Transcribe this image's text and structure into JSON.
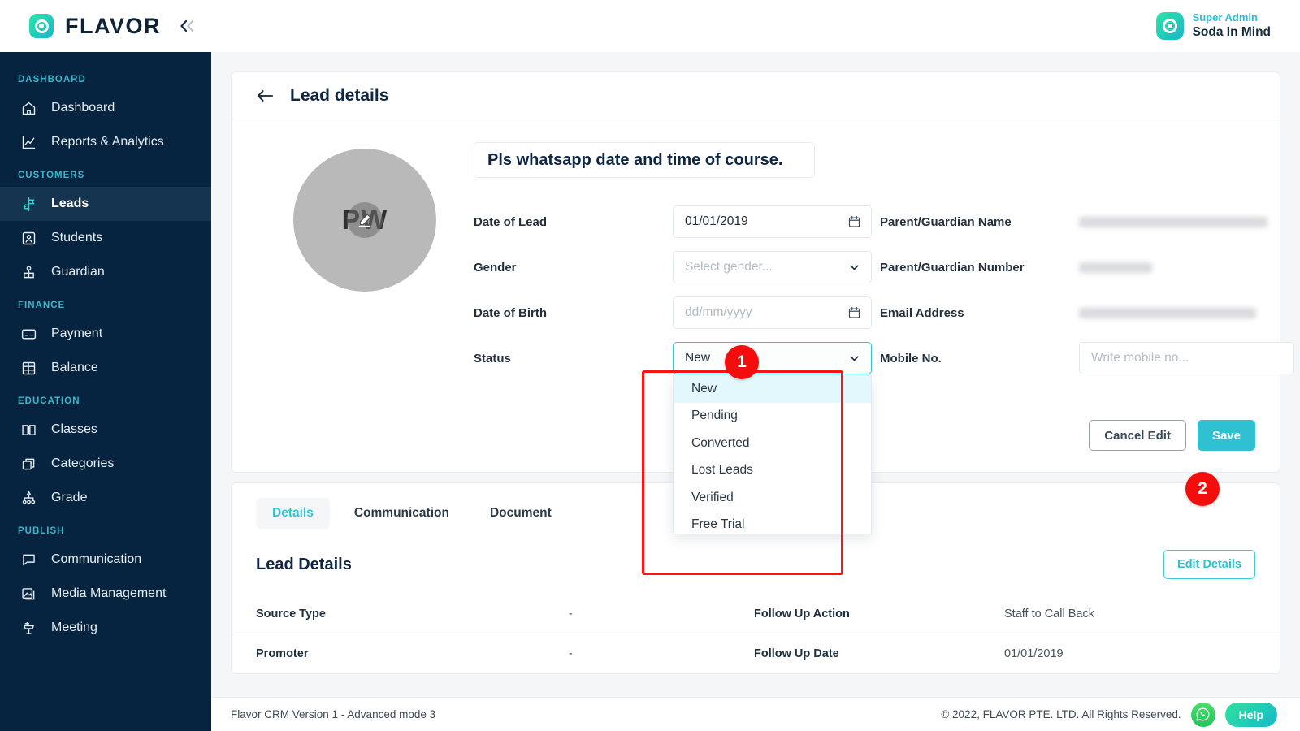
{
  "brand": {
    "name": "FLAVOR",
    "collapse_icon": "double-chevron-left-icon"
  },
  "user": {
    "role": "Super Admin",
    "name": "Soda In Mind"
  },
  "sidebar": {
    "sections": [
      {
        "label": "DASHBOARD",
        "items": [
          {
            "label": "Dashboard",
            "icon": "home-icon",
            "active": false
          },
          {
            "label": "Reports & Analytics",
            "icon": "chart-line-icon",
            "active": false
          }
        ]
      },
      {
        "label": "CUSTOMERS",
        "items": [
          {
            "label": "Leads",
            "icon": "signpost-icon",
            "active": true
          },
          {
            "label": "Students",
            "icon": "id-card-icon",
            "active": false
          },
          {
            "label": "Guardian",
            "icon": "guardian-icon",
            "active": false
          }
        ]
      },
      {
        "label": "FINANCE",
        "items": [
          {
            "label": "Payment",
            "icon": "credit-card-icon",
            "active": false
          },
          {
            "label": "Balance",
            "icon": "ledger-icon",
            "active": false
          }
        ]
      },
      {
        "label": "EDUCATION",
        "items": [
          {
            "label": "Classes",
            "icon": "book-open-icon",
            "active": false
          },
          {
            "label": "Categories",
            "icon": "stacked-boxes-icon",
            "active": false
          },
          {
            "label": "Grade",
            "icon": "hierarchy-icon",
            "active": false
          }
        ]
      },
      {
        "label": "PUBLISH",
        "items": [
          {
            "label": "Communication",
            "icon": "chat-bubble-icon",
            "active": false
          },
          {
            "label": "Media Management",
            "icon": "images-icon",
            "active": false
          },
          {
            "label": "Meeting",
            "icon": "podium-icon",
            "active": false
          }
        ]
      }
    ]
  },
  "page": {
    "title": "Lead details",
    "back_icon": "arrow-left-icon"
  },
  "lead": {
    "avatar_initials": "PW",
    "avatar_edit_icon": "pencil-edit-icon",
    "headline": "Pls whatsapp date and time of course.",
    "left_fields": [
      {
        "label": "Date of Lead",
        "value": "01/01/2019",
        "placeholder": "",
        "type": "date",
        "icon": "calendar-icon",
        "focused": false
      },
      {
        "label": "Gender",
        "value": "",
        "placeholder": "Select gender...",
        "type": "select",
        "icon": "chevron-down-icon",
        "focused": false
      },
      {
        "label": "Date of Birth",
        "value": "",
        "placeholder": "dd/mm/yyyy",
        "type": "date",
        "icon": "calendar-icon",
        "focused": false
      },
      {
        "label": "Status",
        "value": "New",
        "placeholder": "",
        "type": "select",
        "icon": "chevron-down-icon",
        "focused": true
      }
    ],
    "right_fields": [
      {
        "label": "Parent/Guardian Name",
        "value": "",
        "placeholder": "",
        "type": "redacted",
        "redact_width": 232
      },
      {
        "label": "Parent/Guardian Number",
        "value": "",
        "placeholder": "",
        "type": "redacted",
        "redact_width": 90
      },
      {
        "label": "Email Address",
        "value": "",
        "placeholder": "",
        "type": "redacted",
        "redact_width": 218
      },
      {
        "label": "Mobile No.",
        "value": "",
        "placeholder": "Write mobile no...",
        "type": "text"
      }
    ],
    "status_options": [
      {
        "label": "New",
        "selected": true
      },
      {
        "label": "Pending",
        "selected": false
      },
      {
        "label": "Converted",
        "selected": false
      },
      {
        "label": "Lost Leads",
        "selected": false
      },
      {
        "label": "Verified",
        "selected": false
      },
      {
        "label": "Free Trial",
        "selected": false
      }
    ],
    "cancel_label": "Cancel Edit",
    "save_label": "Save"
  },
  "tabs": [
    {
      "label": "Details",
      "active": true
    },
    {
      "label": "Communication",
      "active": false
    },
    {
      "label": "Document",
      "active": false
    }
  ],
  "details": {
    "title": "Lead Details",
    "edit_label": "Edit Details",
    "rows": [
      {
        "key": "Source Type",
        "value": "-",
        "key2": "Follow Up Action",
        "value2": "Staff to Call Back"
      },
      {
        "key": "Promoter",
        "value": "-",
        "key2": "Follow Up Date",
        "value2": "01/01/2019"
      }
    ]
  },
  "annotations": [
    {
      "number": "1"
    },
    {
      "number": "2"
    }
  ],
  "footer": {
    "left": "Flavor CRM Version 1 - Advanced mode 3",
    "right": "© 2022, FLAVOR PTE. LTD. All Rights Reserved.",
    "whatsapp_icon": "whatsapp-icon",
    "help_label": "Help"
  },
  "colors": {
    "accent": "#2fc0d2",
    "sidebar": "#06243f",
    "annotation": "#f40d0d",
    "heading": "#0f2744"
  }
}
